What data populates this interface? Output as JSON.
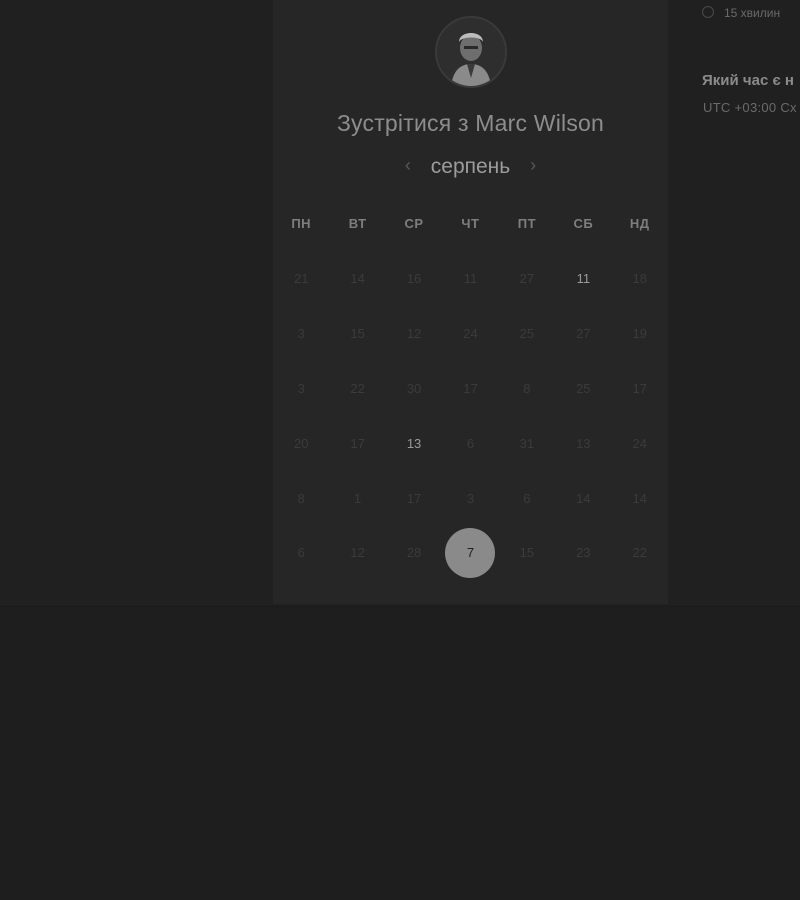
{
  "booking": {
    "title": "Зустрітися з Marc Wilson",
    "month": "серпень",
    "prev_icon": "chevron-left-icon",
    "next_icon": "chevron-right-icon",
    "weekdays": [
      "ПН",
      "ВТ",
      "СР",
      "ЧТ",
      "ПТ",
      "СБ",
      "НД"
    ],
    "weeks": [
      [
        {
          "d": "21",
          "s": "disabled"
        },
        {
          "d": "14",
          "s": "disabled"
        },
        {
          "d": "16",
          "s": "disabled"
        },
        {
          "d": "11",
          "s": "disabled"
        },
        {
          "d": "27",
          "s": "disabled"
        },
        {
          "d": "11",
          "s": "available"
        },
        {
          "d": "18",
          "s": "disabled"
        }
      ],
      [
        {
          "d": "3",
          "s": "disabled"
        },
        {
          "d": "15",
          "s": "disabled"
        },
        {
          "d": "12",
          "s": "disabled"
        },
        {
          "d": "24",
          "s": "disabled"
        },
        {
          "d": "25",
          "s": "disabled"
        },
        {
          "d": "27",
          "s": "disabled"
        },
        {
          "d": "19",
          "s": "disabled"
        }
      ],
      [
        {
          "d": "3",
          "s": "disabled"
        },
        {
          "d": "22",
          "s": "disabled"
        },
        {
          "d": "30",
          "s": "disabled"
        },
        {
          "d": "17",
          "s": "disabled"
        },
        {
          "d": "8",
          "s": "disabled"
        },
        {
          "d": "25",
          "s": "disabled"
        },
        {
          "d": "17",
          "s": "disabled"
        }
      ],
      [
        {
          "d": "20",
          "s": "disabled"
        },
        {
          "d": "17",
          "s": "disabled"
        },
        {
          "d": "13",
          "s": "available"
        },
        {
          "d": "6",
          "s": "disabled"
        },
        {
          "d": "31",
          "s": "disabled"
        },
        {
          "d": "13",
          "s": "disabled"
        },
        {
          "d": "24",
          "s": "disabled"
        }
      ],
      [
        {
          "d": "8",
          "s": "disabled"
        },
        {
          "d": "1",
          "s": "disabled"
        },
        {
          "d": "17",
          "s": "disabled"
        },
        {
          "d": "3",
          "s": "disabled"
        },
        {
          "d": "6",
          "s": "disabled"
        },
        {
          "d": "14",
          "s": "disabled"
        },
        {
          "d": "14",
          "s": "disabled"
        }
      ],
      [
        {
          "d": "6",
          "s": "disabled"
        },
        {
          "d": "12",
          "s": "disabled"
        },
        {
          "d": "28",
          "s": "disabled"
        },
        {
          "d": "7",
          "s": "selected"
        },
        {
          "d": "15",
          "s": "disabled"
        },
        {
          "d": "23",
          "s": "disabled"
        },
        {
          "d": "22",
          "s": "disabled"
        }
      ]
    ]
  },
  "side": {
    "duration": "15 хвилин",
    "question": "Який час є н",
    "timezone": "UTC +03:00 Сх"
  },
  "colors": {
    "background": "#1e1e1e",
    "panel": "#262626",
    "selected_day": "#8a8a8a",
    "available_day": "#9a9a9a",
    "disabled_day": "#3b3b3b"
  }
}
